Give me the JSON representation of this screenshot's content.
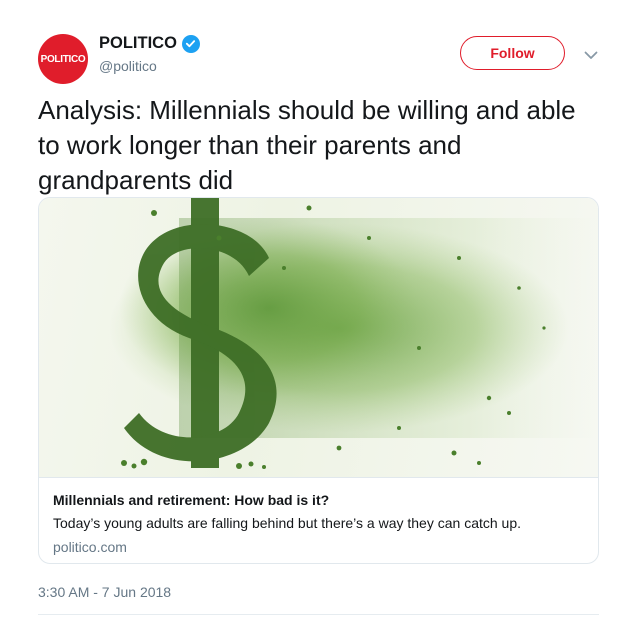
{
  "account": {
    "avatar_text": "POLITICO",
    "display_name": "POLITICO",
    "handle": "@politico",
    "verified": true,
    "brand_color": "#e01d2b"
  },
  "actions": {
    "follow_label": "Follow",
    "more_icon": "chevron-down-icon"
  },
  "tweet": {
    "text": "Analysis: Millennials should be willing and able to work longer than their parents and grandparents did",
    "timestamp": "3:30 AM - 7 Jun 2018"
  },
  "card": {
    "image_subject": "green-dollar-sign-dissolving-into-particles",
    "title": "Millennials and retirement: How bad is it?",
    "description": "Today’s young adults are falling behind but there’s a way they can catch up.",
    "domain": "politico.com"
  },
  "colors": {
    "text": "#14171a",
    "muted": "#657786",
    "verified_blue": "#1da1f2",
    "border": "#e1e8ed"
  }
}
